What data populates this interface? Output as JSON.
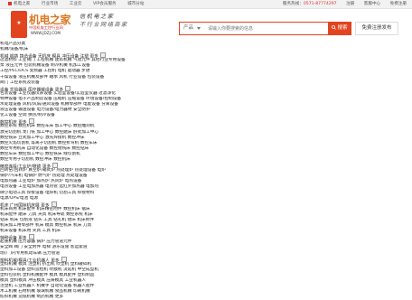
{
  "topbar": {
    "left": [
      "机电之家",
      "行业市场",
      "工业云",
      "VIP会员服务",
      "城市分站"
    ],
    "right": [
      "服务热线：",
      "0571-87774297",
      "注册",
      "客服中心",
      "免费注册"
    ]
  },
  "logo": {
    "name": "机电之家",
    "sub": "中国机电工控行业网",
    "url": "WWW.JDZJ.COM"
  },
  "slogan": {
    "line1": "信机电之家",
    "line2": "不行业网络商家"
  },
  "search": {
    "category": "产品",
    "placeholder": "请输入你要搜索的信息",
    "button": "搜索"
  },
  "publish_button": "免费注册发布",
  "rows": [
    "机电产品分类",
    "机械/设备/机床",
    "机械 锻铸 铸造设备 无机床 模具 冲压设备 注塑 更多",
    "过滤材料 工业阀门 工程机械 建筑机械 气动元件 其他行业专用设备",
    "泵 液压元件 包装机械设备 制冷机械 机加工设备",
    "工控/PLC/DCS 变频器 工控机 电机 驱动器 步进",
    "干燥设备 液压机械及部件 轴承 风机 行业设备 包装设备",
    "阀门 工控系统及装备",
    "设备 实验器具 医疗器械设备 更多",
    "包装设备 工业仪器仪表设备 实验室设备/实验室仪器 过滤净化",
    "特种设备 电子产品制造设备 压缩机 压缩设备 环境设备/控制设备",
    "水处理设备 风机/风扇/通风设备 机械零部件 电能设备 分离设备",
    "液压设备 输送设备 电力设备/电力器材 安全防护",
    "化工设备 空调 换热/制冷设备",
    "数控机床 更多",
    "数控系统 数控机床 数控车床 加工中心 数控雕刻机",
    "激光切割机 龙门铣 加工中心 数控磨床 卧式加工中心",
    "数控铣床 立式加工中心 激光焊接机 数控冲床",
    "数控火焰切割机 等离子切割机 数控折弯机 数控车床",
    "数控专用机床 自动化设备 数控镗铣床 数控钻床",
    "数控车床 数控加工中心 数控铣床 线切割机",
    "数控专用于切割机 数控冲床 数控机床",
    "精密连接/工业炉/联锁 更多",
    "回转窑/回转炉 真空炉/箱式炉 热处理炉 热处理设备 电炉",
    "锅炉/汽车机 电锅炉 燃气炉 热处理 热处理设备",
    "电加热器 工业电炉 加热炉 热风炉 电热设备",
    "电热设备 工业电加热器 电热管 远红外加热器 电加热",
    "微小电动工具 焊接设备 电焊机 切割工具 焊接材料",
    "电源/UPS/电池 电源",
    "机床 广州国际机床展 更多",
    "机床商用 机床配件 机床精密附件 数控机床 锯床",
    "机床配件 磨床 刀具 夹具 机床导轨 数控系统 机床",
    "钻床 机床 切削液 钻头 工具 钻孔机 镗床 机床附件",
    "机床加工用零部件 机床 模具 数控机床 机床 刀具",
    "机床设备 机床用 夹具 工具 机床",
    "特种设备 更多",
    "起重机械 压力容器 锅炉 压力管道元件",
    "安全阀 阀门 安全附件 电梯 游乐设施 客运索道",
    "场(厂)内专用机动车辆 压力管道",
    "塑料机械/模具/工业机器人 更多",
    "塑料机械 模具 注塑机 挤出机 吹塑机 塑料破碎机",
    "塑料加工设备 塑料造粒机 吹膜机 流延机 中空成型机",
    "塑料包装机 塑料机械配件 模具 模具配件 塑料制品",
    "模具 塑料模具 冲压模具 压铸模具 工业机器人",
    "注塑机 工业机器人 机械手 自动化设备 机器人配件",
    "木工机械 石材机械 玻璃机械 食品机械 印刷机械",
    "纺织机械 造纸机械 制药机械 更多"
  ],
  "more_rows": [
    2,
    8,
    14,
    22,
    29,
    35,
    39
  ]
}
